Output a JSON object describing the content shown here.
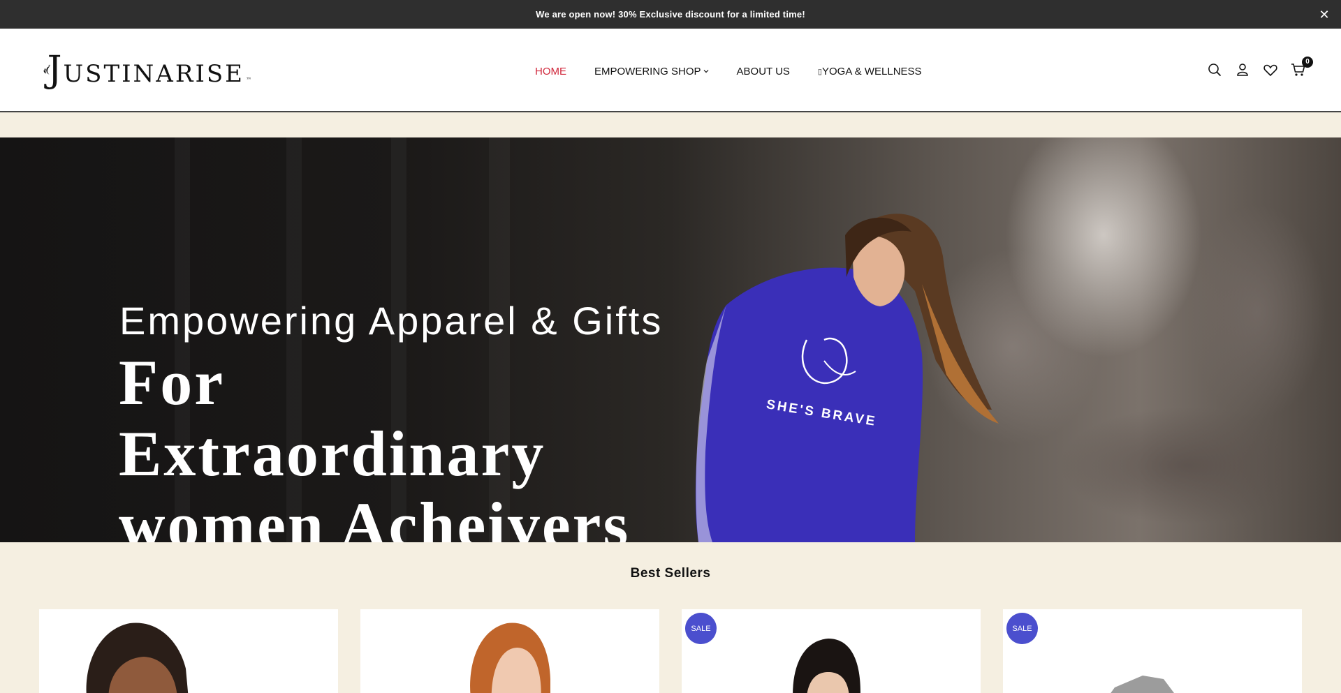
{
  "announcement": {
    "text": "We are open now! 30% Exclusive discount for a limited time!",
    "close_icon": "close-icon"
  },
  "header": {
    "logo": {
      "initial": "J",
      "rest": "USTINARISE",
      "tm": "™"
    },
    "nav": [
      {
        "label": "HOME",
        "active": true
      },
      {
        "label": "EMPOWERING SHOP",
        "has_dropdown": true
      },
      {
        "label": "ABOUT US"
      },
      {
        "label": "YOGA & WELLNESS"
      }
    ],
    "icons": [
      "search-icon",
      "user-icon",
      "heart-icon",
      "cart-icon"
    ],
    "cart_count": "0",
    "accent_color": "#d0263a"
  },
  "hero": {
    "subtitle": "Empowering Apparel & Gifts",
    "title": "For Extraordinary women Acheivers",
    "hoodie_text": "SHE'S BRAVE",
    "hoodie_color": "#3a2fb8"
  },
  "best_sellers": {
    "title": "Best Sellers",
    "products": [
      {
        "badge": ""
      },
      {
        "badge": ""
      },
      {
        "badge": "SALE"
      },
      {
        "badge": "SALE"
      }
    ],
    "badge_color": "#4b4fce"
  }
}
